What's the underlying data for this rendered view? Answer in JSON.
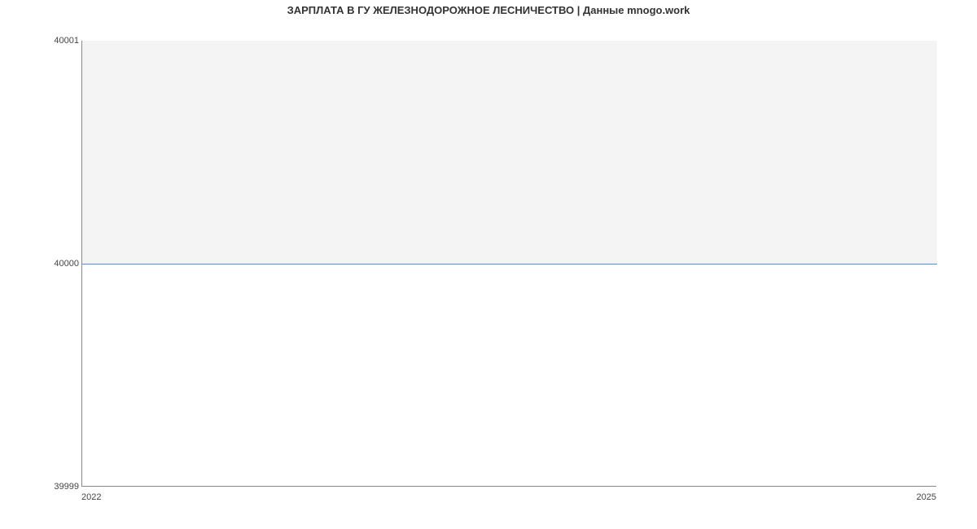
{
  "chart_data": {
    "type": "area",
    "title": "ЗАРПЛАТА В ГУ ЖЕЛЕЗНОДОРОЖНОЕ ЛЕСНИЧЕСТВО | Данные mnogo.work",
    "x": [
      2022,
      2025
    ],
    "values": [
      40000,
      40000
    ],
    "xlabel": "",
    "ylabel": "",
    "xlim": [
      2022,
      2025
    ],
    "ylim": [
      39999,
      40001
    ],
    "x_ticks": [
      "2022",
      "2025"
    ],
    "y_ticks": [
      "39999",
      "40000",
      "40001"
    ],
    "grid": false,
    "fill_above": true,
    "line_color": "#4a8df0",
    "fill_color": "#f4f4f4"
  }
}
